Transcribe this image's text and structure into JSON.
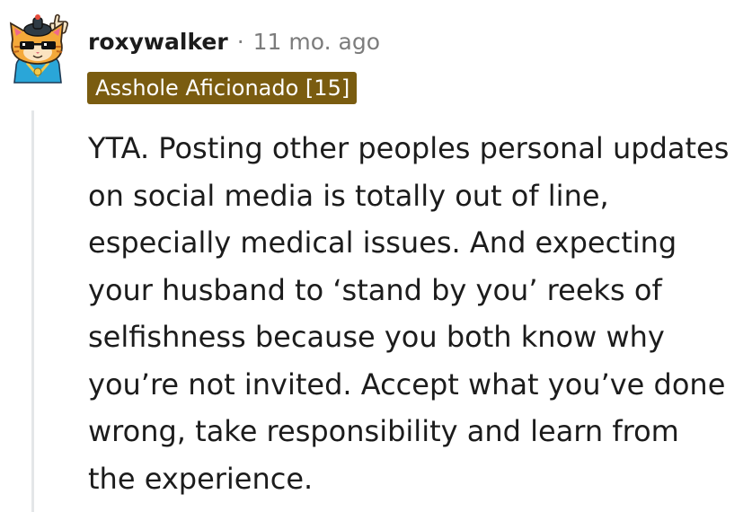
{
  "comment": {
    "author": "roxywalker",
    "separator": "·",
    "timestamp": "11 mo. ago",
    "flair": "Asshole Aficionado [15]",
    "body": "YTA. Posting other peoples personal updates on social media is totally out of line, especially medical issues. And expecting your husband to ‘stand by you’ reeks of selfishness because you both know why you’re not invited. Accept what you’ve done wrong, take responsibility and learn from the experience."
  },
  "colors": {
    "flair_background": "#7a5c10",
    "flair_text": "#ffffff",
    "thread_line": "#e4e6e8",
    "meta_text": "#7c7c7c",
    "body_text": "#1c1c1c"
  },
  "icons": {
    "avatar": "user-avatar-icon"
  }
}
